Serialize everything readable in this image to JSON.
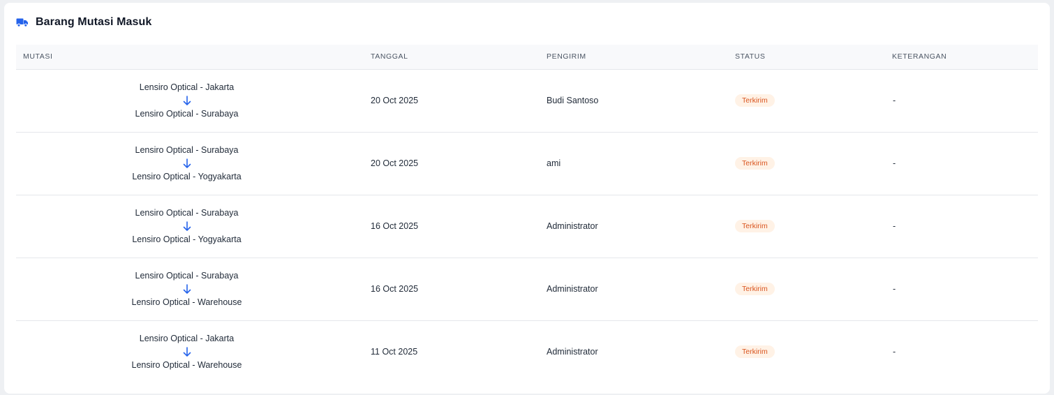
{
  "card": {
    "title": "Barang Mutasi Masuk",
    "icon": "truck-icon",
    "accent": "#2563eb"
  },
  "table": {
    "headers": {
      "mutasi": "MUTASI",
      "tanggal": "TANGGAL",
      "pengirim": "PENGIRIM",
      "status": "STATUS",
      "keterangan": "KETERANGAN"
    },
    "rows": [
      {
        "from": "Lensiro Optical - Jakarta",
        "to": "Lensiro Optical - Surabaya",
        "tanggal": "20 Oct 2025",
        "pengirim": "Budi Santoso",
        "status": "Terkirim",
        "keterangan": "-"
      },
      {
        "from": "Lensiro Optical - Surabaya",
        "to": "Lensiro Optical - Yogyakarta",
        "tanggal": "20 Oct 2025",
        "pengirim": "ami",
        "status": "Terkirim",
        "keterangan": "-"
      },
      {
        "from": "Lensiro Optical - Surabaya",
        "to": "Lensiro Optical - Yogyakarta",
        "tanggal": "16 Oct 2025",
        "pengirim": "Administrator",
        "status": "Terkirim",
        "keterangan": "-"
      },
      {
        "from": "Lensiro Optical - Surabaya",
        "to": "Lensiro Optical - Warehouse",
        "tanggal": "16 Oct 2025",
        "pengirim": "Administrator",
        "status": "Terkirim",
        "keterangan": "-"
      },
      {
        "from": "Lensiro Optical - Jakarta",
        "to": "Lensiro Optical - Warehouse",
        "tanggal": "11 Oct 2025",
        "pengirim": "Administrator",
        "status": "Terkirim",
        "keterangan": "-"
      }
    ],
    "status_colors": {
      "terkirim_bg": "#fff2e6",
      "terkirim_text": "#d9541e"
    },
    "arrow_icon": "arrow-down-icon"
  }
}
